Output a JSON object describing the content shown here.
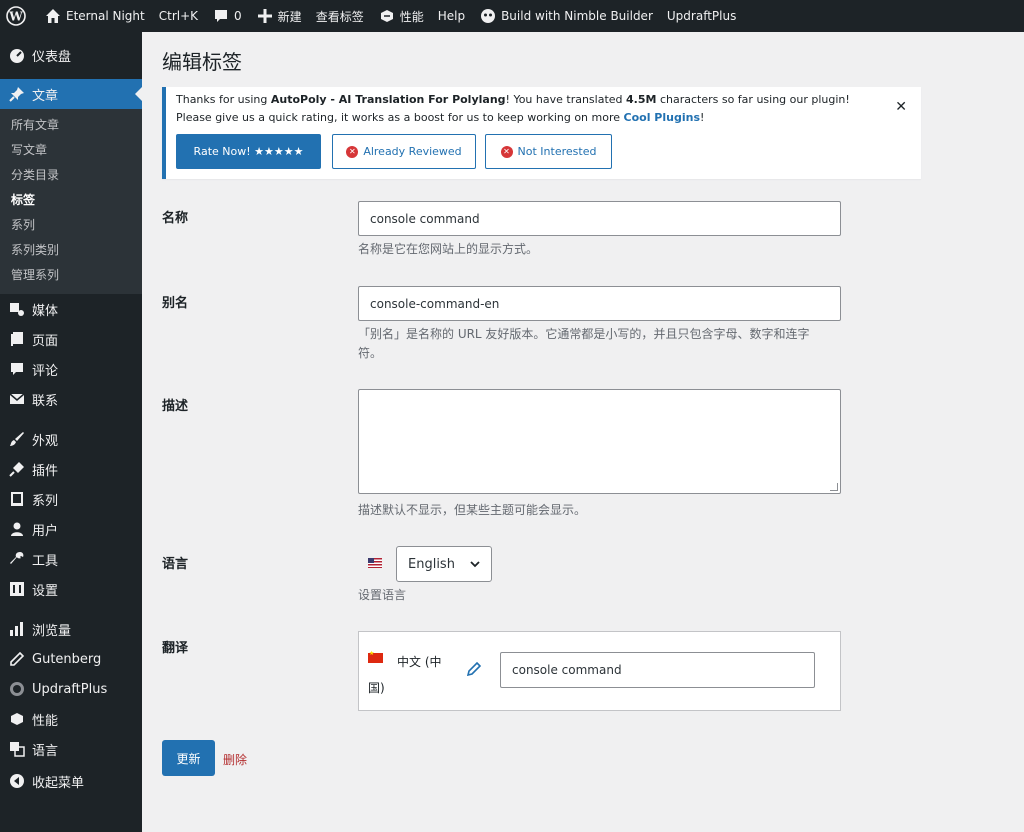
{
  "adminbar": {
    "site_name": "Eternal Night",
    "shortcut": "Ctrl+K",
    "comments_count": "0",
    "new_label": "新建",
    "view_label": "查看标签",
    "performance_label": "性能",
    "help_label": "Help",
    "nimble_label": "Build with Nimble Builder",
    "updraft_label": "UpdraftPlus"
  },
  "sidebar": {
    "dashboard": "仪表盘",
    "posts": "文章",
    "posts_sub": [
      "所有文章",
      "写文章",
      "分类目录",
      "标签",
      "系列",
      "系列类别",
      "管理系列"
    ],
    "media": "媒体",
    "pages": "页面",
    "comments": "评论",
    "contact": "联系",
    "appearance": "外观",
    "plugins": "插件",
    "series": "系列",
    "users": "用户",
    "tools": "工具",
    "settings": "设置",
    "stats": "浏览量",
    "gutenberg": "Gutenberg",
    "updraftplus": "UpdraftPlus",
    "performance": "性能",
    "languages": "语言",
    "collapse": "收起菜单"
  },
  "page": {
    "title": "编辑标签"
  },
  "notice": {
    "line1_a": "Thanks for using ",
    "line1_b": "AutoPoly - AI Translation For Polylang",
    "line1_c": "! You have translated ",
    "line1_d": "4.5M",
    "line1_e": " characters so far using our plugin!",
    "line2_a": "Please give us a quick rating, it works as a boost for us to keep working on more ",
    "line2_link": "Cool Plugins",
    "line2_b": "!",
    "rate_btn": "Rate Now! ★★★★★",
    "reviewed_btn": "Already Reviewed",
    "not_interested_btn": "Not Interested",
    "close": "✕"
  },
  "form": {
    "name_label": "名称",
    "name_value": "console command",
    "name_desc": "名称是它在您网站上的显示方式。",
    "slug_label": "别名",
    "slug_value": "console-command-en",
    "slug_desc_1": "「别名」是名称的 URL 友好版本。它通常都是小写的，并且只包含字母、数字和连字",
    "slug_desc_2": "符。",
    "desc_label": "描述",
    "desc_value": "",
    "desc_desc": "描述默认不显示，但某些主题可能会显示。",
    "lang_label": "语言",
    "lang_value": "English",
    "lang_desc": "设置语言",
    "trans_label": "翻译",
    "trans_lang_1": "中文 (中",
    "trans_lang_2": "国)",
    "trans_value": "console command",
    "update_btn": "更新",
    "delete_link": "删除"
  },
  "colors": {
    "accent": "#2271b1",
    "admin_bg": "#1d2327",
    "delete": "#b32d2e"
  }
}
